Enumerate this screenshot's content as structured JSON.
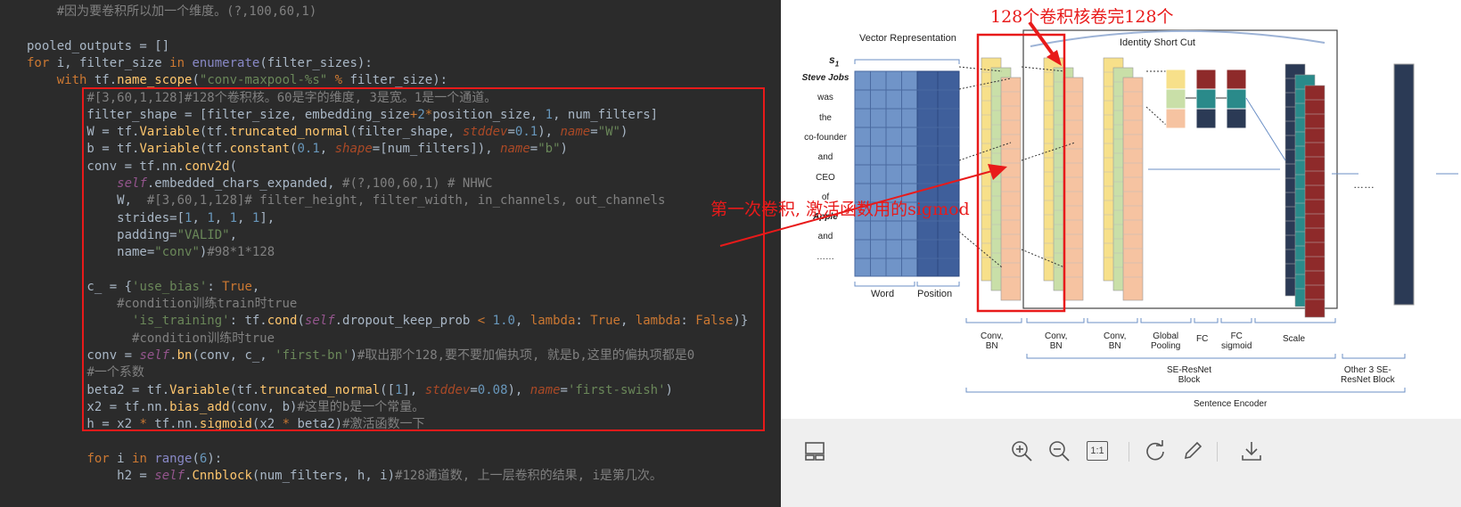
{
  "code": {
    "lines": [
      "    #因为要卷积所以加一个维度。(?,100,60,1)",
      "",
      "pooled_outputs = []",
      "for i, filter_size in enumerate(filter_sizes):",
      "    with tf.name_scope(\"conv-maxpool-%s\" % filter_size):",
      "        #[3,60,1,128]#128个卷积核。60是字的维度, 3是宽。1是一个通道。",
      "        filter_shape = [filter_size, embedding_size+2*position_size, 1, num_filters]",
      "        W = tf.Variable(tf.truncated_normal(filter_shape, stddev=0.1), name=\"W\")",
      "        b = tf.Variable(tf.constant(0.1, shape=[num_filters]), name=\"b\")",
      "        conv = tf.nn.conv2d(",
      "            self.embedded_chars_expanded, #(?,100,60,1) # NHWC",
      "            W,  #[3,60,1,128]# filter_height, filter_width, in_channels, out_channels",
      "            strides=[1, 1, 1, 1],",
      "            padding=\"VALID\",",
      "            name=\"conv\")#98*1*128",
      "",
      "        c_ = {'use_bias': True,",
      "            #condition训练train时true",
      "              'is_training': tf.cond(self.dropout_keep_prob < 1.0, lambda: True, lambda: False)}",
      "              #condition训练时true",
      "        conv = self.bn(conv, c_, 'first-bn')#取出那个128,要不要加偏执项, 就是b,这里的偏执项都是0",
      "        #一个系数",
      "        beta2 = tf.Variable(tf.truncated_normal([1], stddev=0.08), name='first-swish')",
      "        x2 = tf.nn.bias_add(conv, b)#这里的b是一个常量。",
      "        h = x2 * tf.nn.sigmoid(x2 * beta2)#激活函数一下",
      "",
      "        for i in range(6):",
      "            h2 = self.Cnnblock(num_filters, h, i)#128通道数, 上一层卷积的结果, i是第几次。"
    ]
  },
  "annotations": {
    "top": "128个卷积核卷完128个",
    "middle": "第一次卷积, 激活函数用的sigmod"
  },
  "figure": {
    "vector_representation": "Vector Representation",
    "identity_short_cut": "Identity Short Cut",
    "subscript_label": "s",
    "subscript_index": "1",
    "words": [
      "Steve Jobs",
      "was",
      "the",
      "co-founder",
      "and",
      "CEO",
      "of",
      "Apple",
      "and",
      "……"
    ],
    "word_label": "Word",
    "position_label": "Position",
    "dots": "……",
    "stage_labels": {
      "conv1": "Conv,\nBN",
      "conv2": "Conv,\nBN",
      "conv3": "Conv,\nBN",
      "global_pooling": "Global\nPooling",
      "fc1": "FC",
      "fc2": "FC\nsigmoid",
      "scale": "Scale"
    },
    "se_resnet_block": "SE-ResNet\nBlock",
    "other_blocks": "Other 3 SE-\nResNet Block",
    "sentence_encoder": "Sentence Encoder"
  },
  "toolbar": {
    "items": [
      "thumbnails-icon",
      "zoom-in-icon",
      "zoom-out-icon",
      "actual-size-icon",
      "rotate-icon",
      "edit-icon",
      "download-icon"
    ],
    "actual_size_label": "1:1"
  },
  "colors": {
    "annotation_red": "#e81a1a",
    "word_blue": "#7094c8",
    "position_blue": "#3f5f9b",
    "yellow": "#f7e08a",
    "green": "#c9dfa8",
    "peach": "#f6c3a1",
    "red_block": "#8e2a2a",
    "teal": "#2a8a8a",
    "navy": "#2b3a55"
  }
}
